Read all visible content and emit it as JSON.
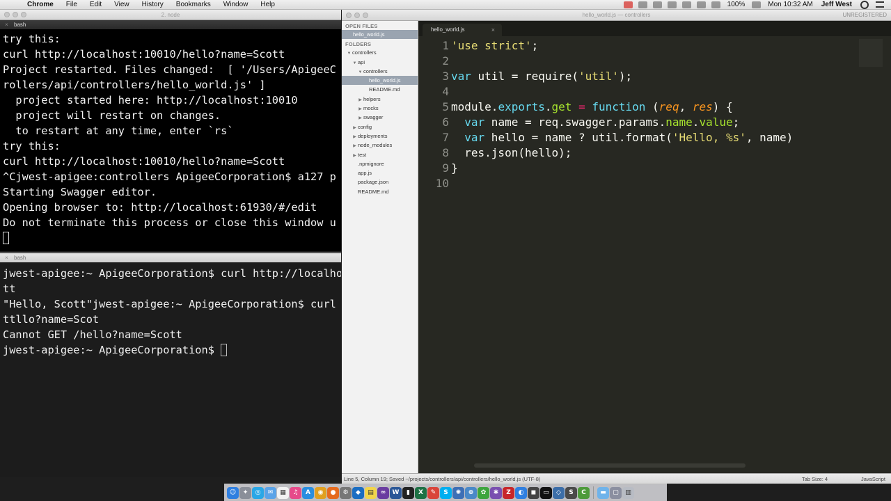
{
  "menubar": {
    "apple": "",
    "items": [
      "Chrome",
      "File",
      "Edit",
      "View",
      "History",
      "Bookmarks",
      "Window",
      "Help"
    ],
    "battery": "100%",
    "clock": "Mon 10:32 AM",
    "user": "Jeff West"
  },
  "node_window": {
    "title": "2. node"
  },
  "terminal_top": {
    "tab": "bash",
    "lines": [
      "try this:",
      "curl http://localhost:10010/hello?name=Scott",
      "Project restarted. Files changed:  [ '/Users/ApigeeC",
      "rollers/api/controllers/hello_world.js' ]",
      "  project started here: http://localhost:10010",
      "  project will restart on changes.",
      "  to restart at any time, enter `rs`",
      "try this:",
      "curl http://localhost:10010/hello?name=Scott",
      "^Cjwest-apigee:controllers ApigeeCorporation$ a127 p",
      "Starting Swagger editor.",
      "Opening browser to: http://localhost:61930/#/edit",
      "Do not terminate this process or close this window u"
    ]
  },
  "terminal_bottom": {
    "tab": "bash",
    "lines": [
      "jwest-apigee:~ ApigeeCorporation$ curl http://localho",
      "tt",
      "\"Hello, Scott\"jwest-apigee:~ ApigeeCorporation$ curl",
      "ttllo?name=Scot",
      "Cannot GET /hello?name=Scott"
    ],
    "prompt": "jwest-apigee:~ ApigeeCorporation$ "
  },
  "sublime": {
    "title": "hello_world.js — controllers",
    "unregistered": "UNREGISTERED",
    "open_files_header": "OPEN FILES",
    "open_files": [
      "hello_world.js"
    ],
    "folders_header": "FOLDERS",
    "tree": [
      {
        "label": "controllers",
        "depth": 0,
        "arrow": "down"
      },
      {
        "label": "api",
        "depth": 1,
        "arrow": "down"
      },
      {
        "label": "controllers",
        "depth": 2,
        "arrow": "down"
      },
      {
        "label": "hello_world.js",
        "depth": 3,
        "arrow": "none",
        "selected": true
      },
      {
        "label": "README.md",
        "depth": 3,
        "arrow": "none"
      },
      {
        "label": "helpers",
        "depth": 2,
        "arrow": "right"
      },
      {
        "label": "mocks",
        "depth": 2,
        "arrow": "right"
      },
      {
        "label": "swagger",
        "depth": 2,
        "arrow": "right"
      },
      {
        "label": "config",
        "depth": 1,
        "arrow": "right"
      },
      {
        "label": "deployments",
        "depth": 1,
        "arrow": "right"
      },
      {
        "label": "node_modules",
        "depth": 1,
        "arrow": "right"
      },
      {
        "label": "test",
        "depth": 1,
        "arrow": "right"
      },
      {
        "label": ".npmignore",
        "depth": 1,
        "arrow": "none"
      },
      {
        "label": "app.js",
        "depth": 1,
        "arrow": "none"
      },
      {
        "label": "package.json",
        "depth": 1,
        "arrow": "none"
      },
      {
        "label": "README.md",
        "depth": 1,
        "arrow": "none"
      }
    ],
    "tab": {
      "label": "hello_world.js",
      "close": "×"
    },
    "line_numbers": [
      "1",
      "2",
      "3",
      "4",
      "5",
      "6",
      "7",
      "8",
      "9",
      "10"
    ],
    "code": [
      [
        {
          "t": "str",
          "v": "'use strict'"
        },
        {
          "t": "",
          "v": ";"
        }
      ],
      [],
      [
        {
          "t": "kw",
          "v": "var"
        },
        {
          "t": "",
          "v": " util = require("
        },
        {
          "t": "str",
          "v": "'util'"
        },
        {
          "t": "",
          "v": ");"
        }
      ],
      [],
      [
        {
          "t": "",
          "v": "module."
        },
        {
          "t": "kw",
          "v": "exports"
        },
        {
          "t": "",
          "v": "."
        },
        {
          "t": "fn",
          "v": "get"
        },
        {
          "t": "",
          "v": " "
        },
        {
          "t": "op",
          "v": "="
        },
        {
          "t": "",
          "v": " "
        },
        {
          "t": "kw",
          "v": "function"
        },
        {
          "t": "",
          "v": " ("
        },
        {
          "t": "prm",
          "v": "req"
        },
        {
          "t": "",
          "v": ", "
        },
        {
          "t": "prm",
          "v": "res"
        },
        {
          "t": "",
          "v": ") {"
        }
      ],
      [
        {
          "t": "",
          "v": "  "
        },
        {
          "t": "kw",
          "v": "var"
        },
        {
          "t": "",
          "v": " name = req.swagger.params."
        },
        {
          "t": "fn",
          "v": "name"
        },
        {
          "t": "",
          "v": "."
        },
        {
          "t": "fn",
          "v": "value"
        },
        {
          "t": "",
          "v": ";"
        }
      ],
      [
        {
          "t": "",
          "v": "  "
        },
        {
          "t": "kw",
          "v": "var"
        },
        {
          "t": "",
          "v": " hello = name ? util.format("
        },
        {
          "t": "str",
          "v": "'Hello, %s'"
        },
        {
          "t": "",
          "v": ", name)"
        }
      ],
      [
        {
          "t": "",
          "v": "  res.json(hello);"
        }
      ],
      [
        {
          "t": "",
          "v": "}"
        }
      ],
      []
    ],
    "status_left": "Line 5, Column 19; Saved ~/projects/controllers/api/controllers/hello_world.js (UTF-8)",
    "tab_size": "Tab Size: 4",
    "syntax": "JavaScript"
  },
  "dock": {
    "icons": [
      {
        "name": "finder-icon",
        "color": "#2f7fe0",
        "glyph": "☺"
      },
      {
        "name": "launchpad-icon",
        "color": "#8a8f99",
        "glyph": "✦"
      },
      {
        "name": "safari-icon",
        "color": "#2aa7e6",
        "glyph": "◎"
      },
      {
        "name": "mail-icon",
        "color": "#5aa3e8",
        "glyph": "✉"
      },
      {
        "name": "calendar-icon",
        "color": "#f2f2f2",
        "glyph": "▦"
      },
      {
        "name": "itunes-icon",
        "color": "#e64a8a",
        "glyph": "♫"
      },
      {
        "name": "app-store-icon",
        "color": "#2a8ee0",
        "glyph": "A"
      },
      {
        "name": "chrome-icon",
        "color": "#e0a020",
        "glyph": "◉"
      },
      {
        "name": "firefox-icon",
        "color": "#e56b1f",
        "glyph": "●"
      },
      {
        "name": "system-prefs-icon",
        "color": "#777",
        "glyph": "⚙"
      },
      {
        "name": "sourcetree-icon",
        "color": "#1a6dc2",
        "glyph": "◆"
      },
      {
        "name": "notes-icon",
        "color": "#f1d44a",
        "glyph": "▤"
      },
      {
        "name": "visual-studio-icon",
        "color": "#6a3ca0",
        "glyph": "∞"
      },
      {
        "name": "word-icon",
        "color": "#2b5797",
        "glyph": "W"
      },
      {
        "name": "terminal-icon",
        "color": "#222",
        "glyph": "▮"
      },
      {
        "name": "excel-icon",
        "color": "#1e7145",
        "glyph": "X"
      },
      {
        "name": "skitch-icon",
        "color": "#d9443a",
        "glyph": "✎"
      },
      {
        "name": "skype-icon",
        "color": "#00aff0",
        "glyph": "S"
      },
      {
        "name": "vpn-icon",
        "color": "#3d6fb6",
        "glyph": "✺"
      },
      {
        "name": "network-icon",
        "color": "#4a89c8",
        "glyph": "⊕"
      },
      {
        "name": "pinwheel-icon",
        "color": "#3da53d",
        "glyph": "✿"
      },
      {
        "name": "xcode-icon",
        "color": "#7a4fb0",
        "glyph": "✱"
      },
      {
        "name": "filezilla-icon",
        "color": "#c8262a",
        "glyph": "Z"
      },
      {
        "name": "browser-icon",
        "color": "#2f7fe0",
        "glyph": "◐"
      },
      {
        "name": "camera-icon",
        "color": "#444",
        "glyph": "◼"
      },
      {
        "name": "console-icon",
        "color": "#111",
        "glyph": "▭"
      },
      {
        "name": "vagrant-icon",
        "color": "#3c6ea8",
        "glyph": "◇"
      },
      {
        "name": "sublime-icon",
        "color": "#4a4a4a",
        "glyph": "S"
      },
      {
        "name": "coda-icon",
        "color": "#4d9a3a",
        "glyph": "C"
      }
    ],
    "right_icons": [
      {
        "name": "folder-icon",
        "color": "#6fb3ea",
        "glyph": "▬"
      },
      {
        "name": "downloads-icon",
        "color": "#8b8fa0",
        "glyph": "▢"
      },
      {
        "name": "trash-icon",
        "color": "#b8bcc4",
        "glyph": "▥"
      }
    ]
  }
}
